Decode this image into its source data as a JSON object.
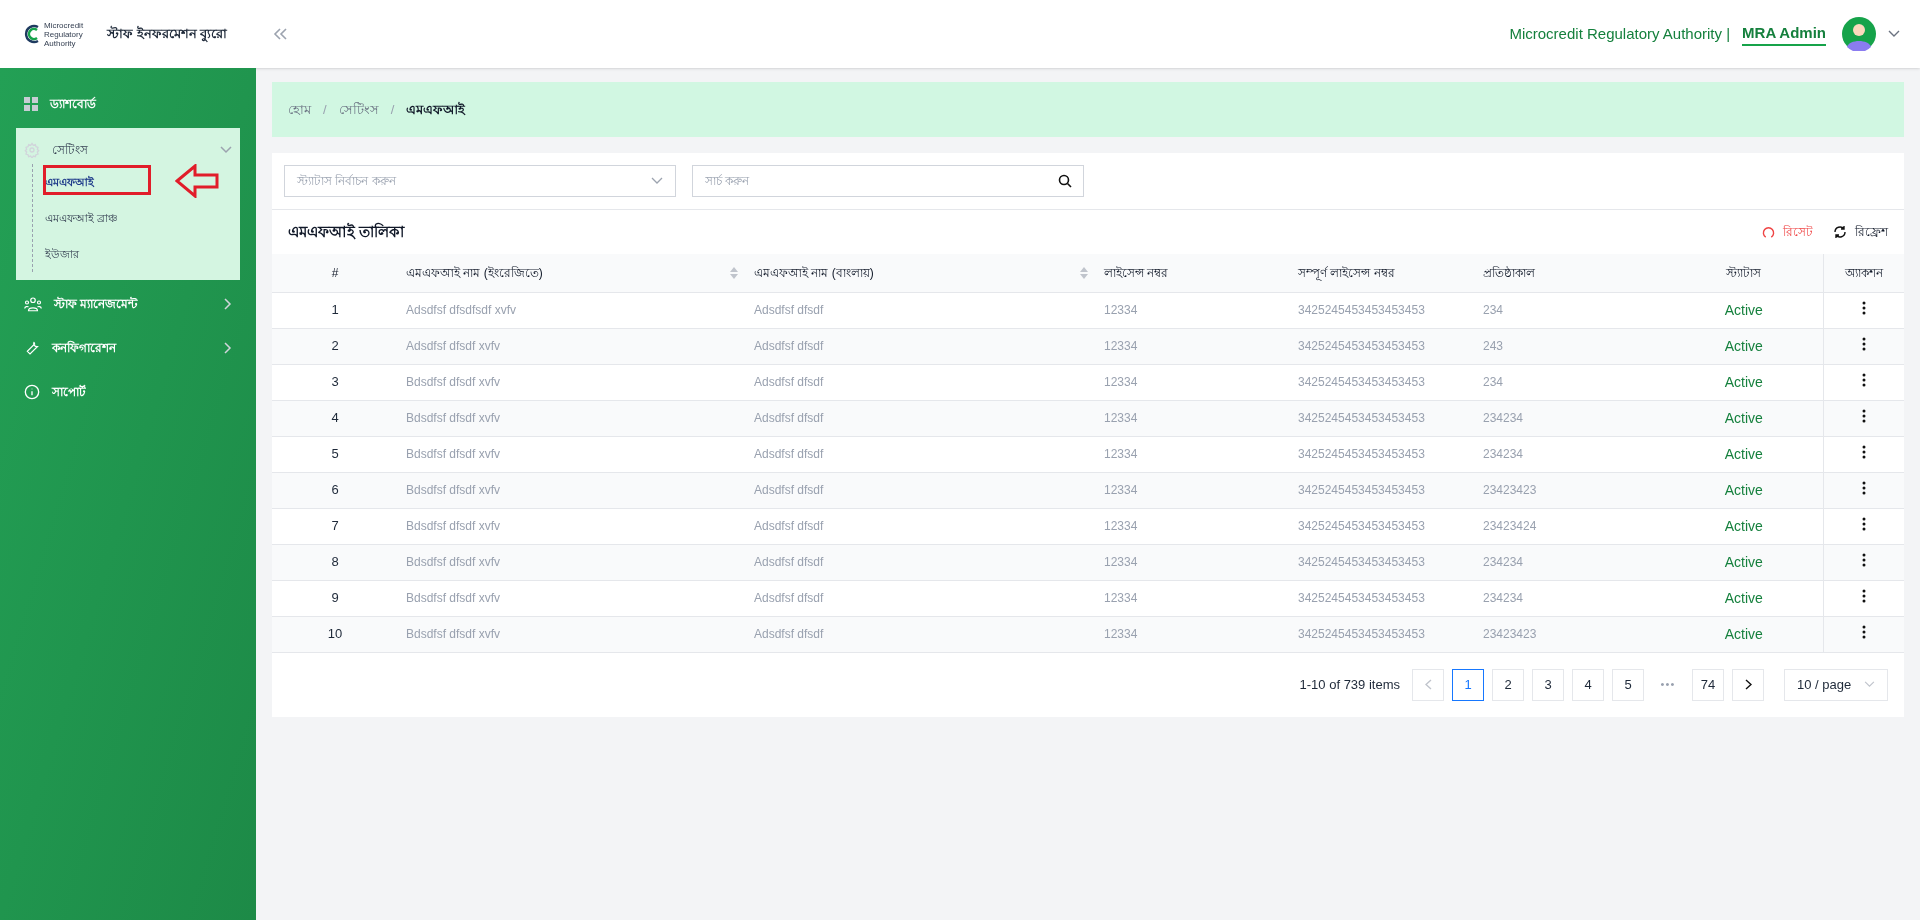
{
  "header": {
    "logo_text": [
      "Microcredit",
      "Regulatory",
      "Authority"
    ],
    "app_title": "স্টাফ ইনফরমেশন ব্যুরো",
    "org": "Microcredit Regulatory Authority |",
    "user": "MRA Admin"
  },
  "sidebar": {
    "items": [
      {
        "label": "ড্যাশবোর্ড",
        "kind": "dashboard",
        "expanded": false
      },
      {
        "label": "সেটিংস",
        "kind": "settings",
        "expanded": true,
        "children": [
          {
            "label": "এমএফআই",
            "selected": true
          },
          {
            "label": "এমএফআই ব্রাঞ্চ",
            "selected": false
          },
          {
            "label": "ইউজার",
            "selected": false
          }
        ]
      },
      {
        "label": "স্টাফ ম্যানেজমেন্ট",
        "kind": "staff",
        "expanded": false
      },
      {
        "label": "কনফিগারেশন",
        "kind": "config",
        "expanded": false
      },
      {
        "label": "সাপোর্ট",
        "kind": "support",
        "expanded": false
      }
    ]
  },
  "breadcrumb": {
    "separator": "/",
    "items": [
      "হোম",
      "সেটিংস",
      "এমএফআই"
    ]
  },
  "filters": {
    "status_placeholder": "স্ট্যাটাস নির্বাচন করুন",
    "search_placeholder": "সার্চ করুন"
  },
  "table": {
    "title": "এমএফআই তালিকা",
    "reset": "রিসেট",
    "refresh": "রিফ্রেশ",
    "columns": [
      {
        "label": "#",
        "sortable": false
      },
      {
        "label": "এমএফআই নাম (ইংরেজিতে)",
        "sortable": true
      },
      {
        "label": "এমএফআই নাম (বাংলায়)",
        "sortable": true
      },
      {
        "label": "লাইসেন্স নম্বর",
        "sortable": false
      },
      {
        "label": "সম্পূর্ণ লাইসেন্স নম্বর",
        "sortable": false
      },
      {
        "label": "প্রতিষ্ঠাকাল",
        "sortable": false
      },
      {
        "label": "স্ট্যাটাস",
        "sortable": false
      },
      {
        "label": "অ্যাকশন",
        "sortable": false
      }
    ],
    "rows": [
      [
        "1",
        "Adsdfsf dfsdfsdf xvfv",
        "Adsdfsf dfsdf",
        "12334",
        "3425245453453453453",
        "234",
        "Active"
      ],
      [
        "2",
        "Adsdfsf dfsdf xvfv",
        "Adsdfsf dfsdf",
        "12334",
        "3425245453453453453",
        "243",
        "Active"
      ],
      [
        "3",
        "Bdsdfsf dfsdf xvfv",
        "Adsdfsf dfsdf",
        "12334",
        "3425245453453453453",
        "234",
        "Active"
      ],
      [
        "4",
        "Bdsdfsf dfsdf xvfv",
        "Adsdfsf dfsdf",
        "12334",
        "3425245453453453453",
        "234234",
        "Active"
      ],
      [
        "5",
        "Bdsdfsf dfsdf xvfv",
        "Adsdfsf dfsdf",
        "12334",
        "3425245453453453453",
        "234234",
        "Active"
      ],
      [
        "6",
        "Bdsdfsf dfsdf xvfv",
        "Adsdfsf dfsdf",
        "12334",
        "3425245453453453453",
        "23423423",
        "Active"
      ],
      [
        "7",
        "Bdsdfsf dfsdf xvfv",
        "Adsdfsf dfsdf",
        "12334",
        "3425245453453453453",
        "23423424",
        "Active"
      ],
      [
        "8",
        "Bdsdfsf dfsdf xvfv",
        "Adsdfsf dfsdf",
        "12334",
        "3425245453453453453",
        "234234",
        "Active"
      ],
      [
        "9",
        "Bdsdfsf dfsdf xvfv",
        "Adsdfsf dfsdf",
        "12334",
        "3425245453453453453",
        "234234",
        "Active"
      ],
      [
        "10",
        "Bdsdfsf dfsdf xvfv",
        "Adsdfsf dfsdf",
        "12334",
        "3425245453453453453",
        "23423423",
        "Active"
      ]
    ]
  },
  "pagination": {
    "summary": "1-10 of 739 items",
    "pages": [
      {
        "label": "1",
        "selected": true
      },
      {
        "label": "2",
        "selected": false
      },
      {
        "label": "3",
        "selected": false
      },
      {
        "label": "4",
        "selected": false
      },
      {
        "label": "5",
        "selected": false
      },
      {
        "label": "•••",
        "selected": false
      },
      {
        "label": "74",
        "selected": false
      }
    ],
    "page_size": "10 / page"
  }
}
